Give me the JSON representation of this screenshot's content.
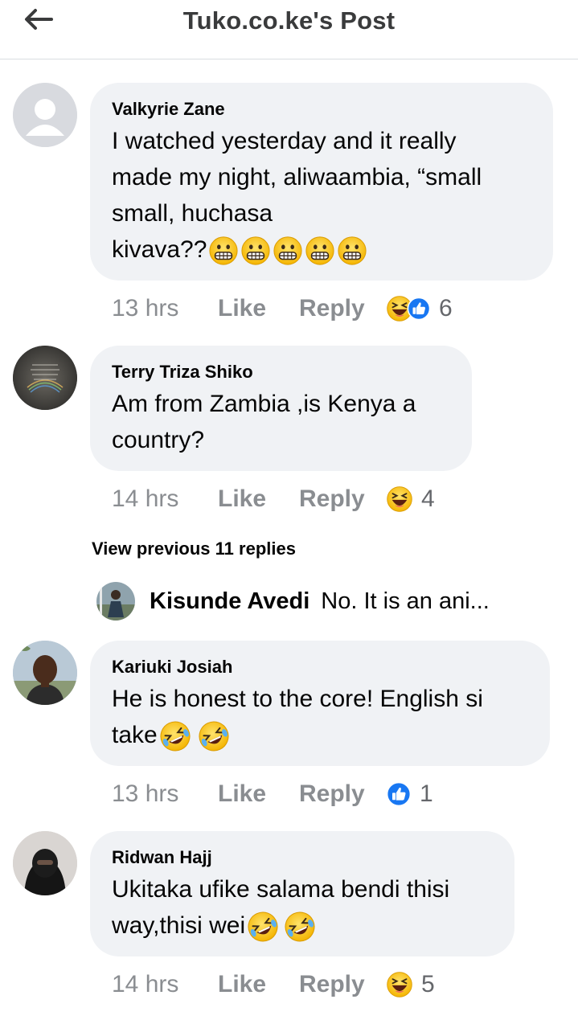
{
  "header": {
    "title": "Tuko.co.ke's Post"
  },
  "comments": [
    {
      "author": "Valkyrie Zane",
      "text_lines": [
        "I watched yesterday and it really",
        "made my night, aliwaambia, “small",
        "small, huchasa",
        "kivava??"
      ],
      "emoji": [
        "grimacing",
        "grimacing",
        "grimacing",
        "grimacing",
        "grimacing"
      ],
      "time": "13 hrs",
      "like": "Like",
      "reply": "Reply",
      "reactions": [
        "haha",
        "like"
      ],
      "count": "6"
    },
    {
      "author": "Terry Triza Shiko",
      "text_lines": [
        "Am from Zambia ,is Kenya a",
        "country?"
      ],
      "time": "14 hrs",
      "like": "Like",
      "reply": "Reply",
      "reactions": [
        "haha"
      ],
      "count": "4"
    },
    {
      "author": "Kariuki Josiah",
      "text_lines": [
        "He is honest to the core! English si",
        "take"
      ],
      "emoji": [
        "rolling-laughing",
        "rolling-laughing"
      ],
      "time": "13 hrs",
      "like": "Like",
      "reply": "Reply",
      "reactions": [
        "like"
      ],
      "count": "1"
    },
    {
      "author": "Ridwan Hajj",
      "text_lines": [
        "Ukitaka ufike salama bendi thisi",
        "way,thisi wei"
      ],
      "emoji": [
        "rolling-laughing",
        "rolling-laughing"
      ],
      "time": "14 hrs",
      "like": "Like",
      "reply": "Reply",
      "reactions": [
        "haha"
      ],
      "count": "5"
    }
  ],
  "view_previous": "View previous 11 replies",
  "reply_preview": {
    "name": "Kisunde Avedi",
    "text": "No. It is an ani..."
  }
}
